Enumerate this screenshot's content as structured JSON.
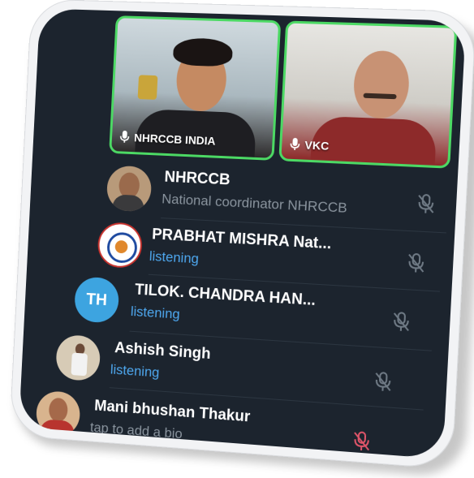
{
  "videos": [
    {
      "label": "NHRCCB INDIA"
    },
    {
      "label": "VKC"
    }
  ],
  "participants": [
    {
      "name": "NHRCCB",
      "subtitle": "National coordinator NHRCCB",
      "status_color": "gray",
      "mic": "muted"
    },
    {
      "name": "PRABHAT MISHRA Nat...",
      "subtitle": "listening",
      "status_color": "blue",
      "mic": "muted"
    },
    {
      "name": "TILOK. CHANDRA HAN...",
      "initials": "TH",
      "subtitle": "listening",
      "status_color": "blue",
      "mic": "muted"
    },
    {
      "name": "Ashish Singh",
      "subtitle": "listening",
      "status_color": "blue",
      "mic": "muted"
    },
    {
      "name": "Mani bhushan Thakur",
      "subtitle": "tap to add a bio",
      "status_color": "gray",
      "mic": "muted-red"
    }
  ],
  "colors": {
    "background": "#1c242e",
    "speaking_border": "#4cd964",
    "listening": "#4ea8f0",
    "muted_icon": "#6f7a85",
    "muted_red": "#e0556a",
    "avatar_initials_bg": "#3da4e0"
  }
}
